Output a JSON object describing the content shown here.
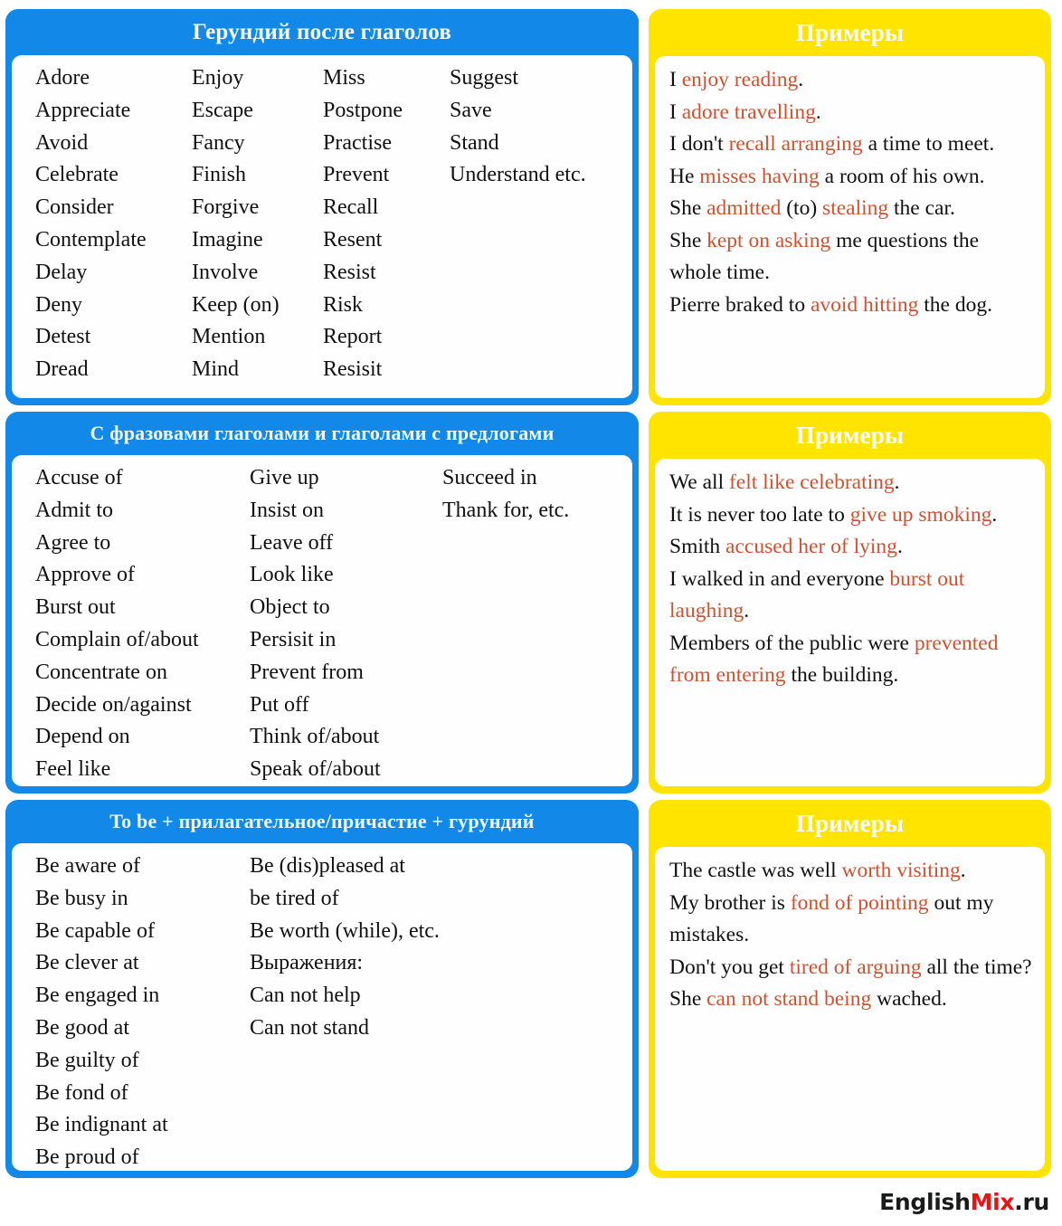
{
  "colors": {
    "blue": "#1289e8",
    "yellow": "#ffe400",
    "highlight": "#cf5130",
    "text": "#111111",
    "card": "#fefefe",
    "logo_accent": "#ee1111"
  },
  "panels": {
    "verbs": {
      "title": "Герундий после глаголов",
      "columns": [
        [
          "Adore",
          "Appreciate",
          "Avoid",
          "Celebrate",
          "Consider",
          "Contemplate",
          "Delay",
          "Deny",
          "Detest",
          "Dread"
        ],
        [
          "Enjoy",
          "Escape",
          "Fancy",
          "Finish",
          "Forgive",
          "Imagine",
          "Involve",
          "Keep (on)",
          "Mention",
          "Mind"
        ],
        [
          "Miss",
          "Postpone",
          "Practise",
          "Prevent",
          "Recall",
          "Resent",
          "Resist",
          "Risk",
          "Report",
          "Resisit"
        ],
        [
          "Suggest",
          "Save",
          "Stand",
          "Understand etc."
        ]
      ]
    },
    "phrasal": {
      "title": "С фразовами глаголами и глаголами с предлогами",
      "columns": [
        [
          "Accuse of",
          "Admit to",
          "Agree to",
          "Approve of",
          "Burst out",
          "Complain of/about",
          "Concentrate on",
          "Decide on/against",
          "Depend on",
          "Feel like"
        ],
        [
          "Give up",
          "Insist on",
          "Leave off",
          "Look like",
          "Object to",
          "Persisit in",
          "Prevent from",
          "Put off",
          "Think of/about",
          "Speak of/about"
        ],
        [
          "Succeed in",
          "Thank for, etc."
        ]
      ]
    },
    "tobe": {
      "title": "To be + прилагательное/причастие + гурундий",
      "columns": [
        [
          "Be aware of",
          "Be busy in",
          "Be capable of",
          "Be clever at",
          "Be engaged in",
          "Be good at",
          "Be guilty of",
          "Be fond of",
          "Be indignant at",
          "Be proud of"
        ],
        [
          "Be (dis)pleased at",
          "be tired of",
          "Be worth (while), etc.",
          "Выражения:",
          "Can not help",
          "Can not stand"
        ]
      ]
    }
  },
  "examples": {
    "title": "Примеры",
    "verbs": [
      [
        {
          "t": "I ",
          "h": false
        },
        {
          "t": "enjoy reading",
          "h": true
        },
        {
          "t": ".",
          "h": false
        }
      ],
      [
        {
          "t": "I ",
          "h": false
        },
        {
          "t": "adore travelling",
          "h": true
        },
        {
          "t": ".",
          "h": false
        }
      ],
      [
        {
          "t": "I don't ",
          "h": false
        },
        {
          "t": "recall arranging",
          "h": true
        },
        {
          "t": " a time to meet.",
          "h": false
        }
      ],
      [
        {
          "t": "He ",
          "h": false
        },
        {
          "t": "misses having",
          "h": true
        },
        {
          "t": " a room of his own.",
          "h": false
        }
      ],
      [
        {
          "t": "She ",
          "h": false
        },
        {
          "t": "admitted",
          "h": true
        },
        {
          "t": " (to) ",
          "h": false
        },
        {
          "t": "stealing",
          "h": true
        },
        {
          "t": " the car.",
          "h": false
        }
      ],
      [
        {
          "t": "She ",
          "h": false
        },
        {
          "t": "kept on asking",
          "h": true
        },
        {
          "t": " me questions the whole time.",
          "h": false
        }
      ],
      [
        {
          "t": "Pierre braked to ",
          "h": false
        },
        {
          "t": "avoid hitting",
          "h": true
        },
        {
          "t": " the dog.",
          "h": false
        }
      ]
    ],
    "phrasal": [
      [
        {
          "t": "We all ",
          "h": false
        },
        {
          "t": "felt like celebrating",
          "h": true
        },
        {
          "t": ".",
          "h": false
        }
      ],
      [
        {
          "t": "It is never too late to ",
          "h": false
        },
        {
          "t": "give up smoking",
          "h": true
        },
        {
          "t": ".",
          "h": false
        }
      ],
      [
        {
          "t": "Smith ",
          "h": false
        },
        {
          "t": "accused her of lying",
          "h": true
        },
        {
          "t": ".",
          "h": false
        }
      ],
      [
        {
          "t": "I walked in and everyone ",
          "h": false
        },
        {
          "t": "burst out laughing",
          "h": true
        },
        {
          "t": ".",
          "h": false
        }
      ],
      [
        {
          "t": " Members of the public were ",
          "h": false
        },
        {
          "t": "prevented from entering",
          "h": true
        },
        {
          "t": " the building.",
          "h": false
        }
      ]
    ],
    "tobe": [
      [
        {
          "t": "The castle was well ",
          "h": false
        },
        {
          "t": "worth visiting",
          "h": true
        },
        {
          "t": ".",
          "h": false
        }
      ],
      [
        {
          "t": "My brother is ",
          "h": false
        },
        {
          "t": "fond of pointing",
          "h": true
        },
        {
          "t": " out my mistakes.",
          "h": false
        }
      ],
      [
        {
          "t": "Don't you get ",
          "h": false
        },
        {
          "t": "tired of arguing",
          "h": true
        },
        {
          "t": " all the time?",
          "h": false
        }
      ],
      [
        {
          "t": "She ",
          "h": false
        },
        {
          "t": "can not stand being",
          "h": true
        },
        {
          "t": " wached.",
          "h": false
        }
      ]
    ]
  },
  "footer": {
    "brand_1": "English",
    "brand_2": "Mix",
    "brand_3": ".ru"
  }
}
